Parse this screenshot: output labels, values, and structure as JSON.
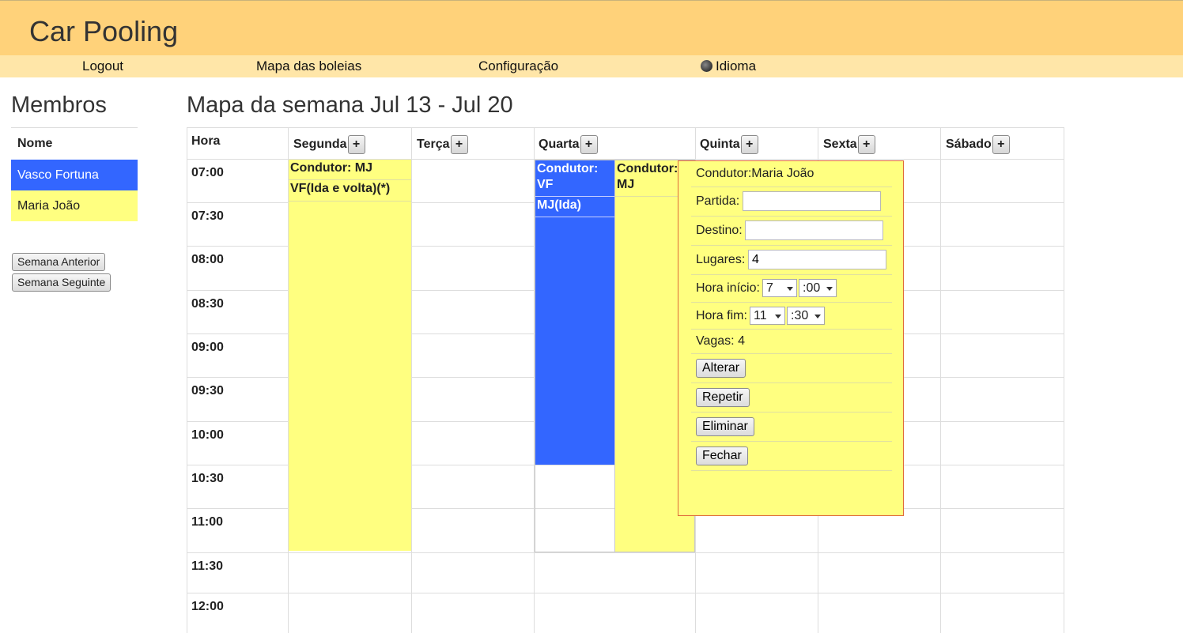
{
  "header": {
    "title": "Car Pooling"
  },
  "nav": {
    "logout": "Logout",
    "map": "Mapa das boleias",
    "config": "Configuração",
    "language": "Idioma"
  },
  "members": {
    "title": "Membros",
    "column": "Nome",
    "items": [
      {
        "name": "Vasco Fortuna",
        "color": "#3366ff"
      },
      {
        "name": "Maria João",
        "color": "#ffff80"
      }
    ],
    "prev_week": "Semana Anterior",
    "next_week": "Semana Seguinte"
  },
  "week": {
    "title": "Mapa da semana Jul 13 - Jul 20",
    "hour_header": "Hora",
    "days": [
      "Segunda",
      "Terça",
      "Quarta",
      "Quinta",
      "Sexta",
      "Sábado"
    ],
    "add_label": "+",
    "times": [
      "07:00",
      "07:30",
      "08:00",
      "08:30",
      "09:00",
      "09:30",
      "10:00",
      "10:30",
      "11:00",
      "11:30",
      "12:00"
    ]
  },
  "rides": {
    "monday": {
      "driver": "Condutor: MJ",
      "passenger": "VF(Ida e volta)(*)"
    },
    "wednesday_vf": {
      "driver": "Condutor: VF",
      "passenger": "MJ(Ida)"
    },
    "wednesday_mj": {
      "driver": "Condutor: MJ"
    }
  },
  "popup": {
    "driver": "Condutor:Maria João",
    "partida_label": "Partida:",
    "partida_value": "",
    "destino_label": "Destino:",
    "destino_value": "",
    "lugares_label": "Lugares:",
    "lugares_value": "4",
    "start_label": "Hora início:",
    "start_hour": "7",
    "start_min": ":00",
    "end_label": "Hora fim:",
    "end_hour": "11",
    "end_min": ":30",
    "vagas": "Vagas: 4",
    "alterar": "Alterar",
    "repetir": "Repetir",
    "eliminar": "Eliminar",
    "fechar": "Fechar"
  }
}
